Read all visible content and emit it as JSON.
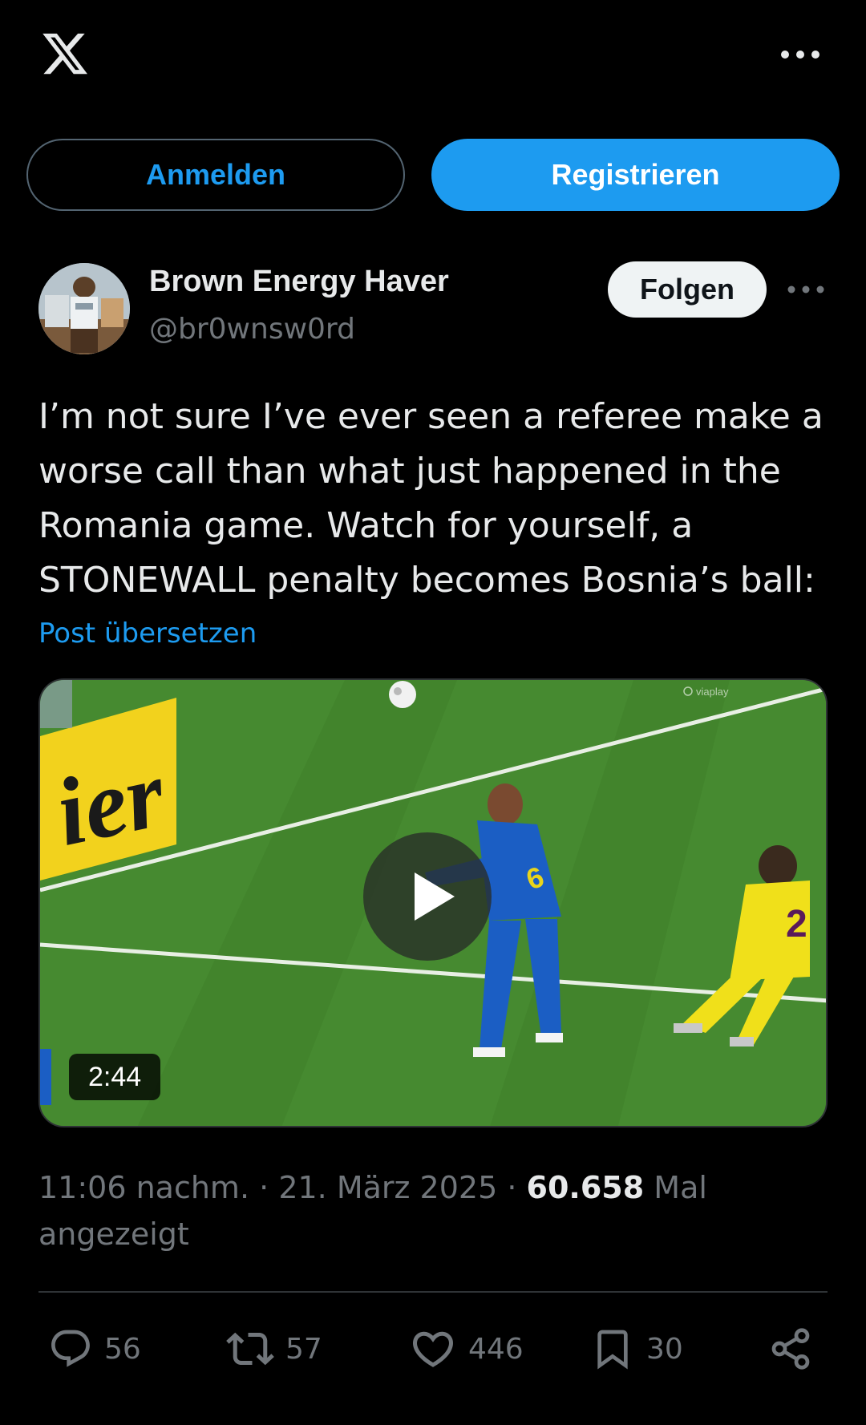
{
  "header": {
    "logo_icon": "x-logo-icon",
    "more_icon": "more-horizontal-icon"
  },
  "auth": {
    "login_label": "Anmelden",
    "register_label": "Registrieren"
  },
  "post": {
    "author_name": "Brown Energy Haver",
    "author_handle": "@br0wnsw0rd",
    "follow_label": "Folgen",
    "text": "I’m not sure I’ve ever seen a referee make a worse call than what just happened in the Romania game. Watch for yourself, a STONEWALL penalty becomes Bosnia’s ball:",
    "translate_label": "Post übersetzen",
    "video": {
      "duration": "2:44"
    },
    "time": "11:06 nachm.",
    "date": "21. März 2025",
    "separator": "·",
    "views_count": "60.658",
    "views_label": "Mal angezeigt"
  },
  "actions": {
    "replies": "56",
    "reposts": "57",
    "likes": "446",
    "bookmarks": "30"
  },
  "colors": {
    "accent": "#1d9bf0",
    "background": "#000000",
    "text_primary": "#e7e9ea",
    "text_secondary": "#71767b",
    "border": "#2f3336"
  }
}
